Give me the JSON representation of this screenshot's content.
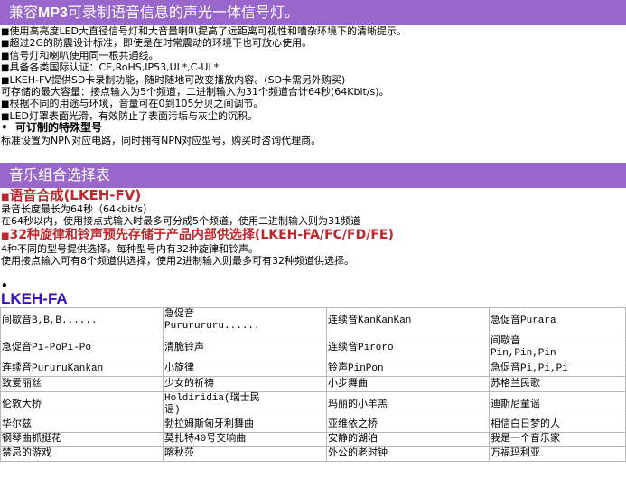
{
  "section1": {
    "header_prefix": "兼容",
    "header_bold": "MP3",
    "header_suffix": "可录制语音信息的声光一体信号灯。",
    "lines": [
      "使用高亮度LED大直径信号灯和大音量喇叭提高了远距离可视性和嘈杂环境下的清晰提示。",
      "超过2G的防震设计标准，即使是在时常震动的环境下也可放心使用。",
      "信号灯和喇叭使用同一根共通线。",
      "具备各类国际认证：CE,RoHS,IP53,UL*,C-UL*",
      "LKEH-FV提供SD卡录制功能，随时随地可改变播放内容。(SD卡需另外购买)",
      "可存储的最大容量：接点输入为5个频道，二进制输入为31个频道合计64秒(64Kbit/s)。",
      "根据不同的用途与环境，音量可在0到105分贝之间调节。",
      "LED灯罩表面光滑，有效防止了表面污垢与灰尘的沉积。"
    ],
    "custom_title": "可订制的特殊型号",
    "custom_desc": "标准设置为NPN对应电路，同时拥有NPN对应型号，购买时咨询代理商。"
  },
  "section2": {
    "header": "音乐组合选择表",
    "voice_title": "语音合成(LKEH-FV)",
    "voice_lines": [
      "录音长度最长为64秒（64kbit/s）",
      "在64秒以内，使用接点式输入时最多可分成5个频道，使用二进制输入则为31频道"
    ],
    "melody_title": "32种旋律和铃声预先存储于产品内部供选择(LKEH-FA/FC/FD/FE)",
    "melody_lines": [
      "4种不同的型号提供选择，每种型号内有32种旋律和铃声。",
      "使用接点输入可有8个频道供选择，使用2进制输入则最多可有32种频道供选择。"
    ],
    "bullet": "•",
    "table_title": "LKEH-FA",
    "rows": [
      [
        "间歇音B,B,B......",
        "急促音\nPururururu......",
        "连续音KanKanKan",
        "急促音Purara"
      ],
      [
        "急促音Pi-PoPi-Po",
        "清脆铃声",
        "连续音Piroro",
        "间歇音\nPin,Pin,Pin"
      ],
      [
        "连续音PururuKankan",
        "小旋律",
        "铃声PinPon",
        "急促音Pi,Pi,Pi"
      ],
      [
        "致爱丽丝",
        "少女的祈祷",
        "小步舞曲",
        "苏格兰民歌"
      ],
      [
        "伦敦大桥",
        "Holdiridia(瑞士民\n谣)",
        "玛丽的小羊羔",
        "迪斯尼童谣"
      ],
      [
        "华尔兹",
        "勃拉姆斯匈牙利舞曲",
        "亚维依之桥",
        "相信白日梦的人"
      ],
      [
        "钢琴曲抓挺花",
        "莫扎特40号交响曲",
        "安静的湖泊",
        "我是一个音乐家"
      ],
      [
        "禁忌的游戏",
        "喀秋莎",
        "外公的老时钟",
        "万福玛利亚"
      ]
    ]
  }
}
